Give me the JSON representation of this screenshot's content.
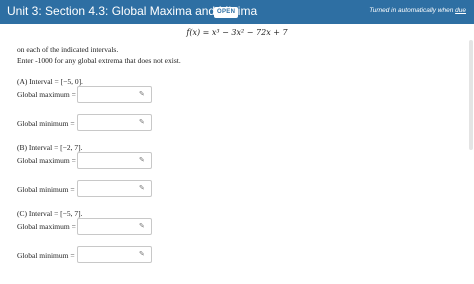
{
  "header": {
    "title": "Unit 3: Section 4.3: Global Maxima and Minima",
    "badge": "OPEN",
    "notice_prefix": "Turned in automatically when ",
    "notice_link": "due"
  },
  "problem": {
    "formula": "f(x) = x³ − 3x² − 72x + 7",
    "instruction_1": "on each of the indicated intervals.",
    "instruction_2": "Enter -1000 for any global extrema that does not exist."
  },
  "parts": [
    {
      "label": "(A) Interval = [−5, 0].",
      "max_label": "Global maximum =",
      "min_label": "Global minimum =",
      "max_value": "",
      "min_value": ""
    },
    {
      "label": "(B) Interval = [−2, 7].",
      "max_label": "Global maximum =",
      "min_label": "Global minimum =",
      "max_value": "",
      "min_value": ""
    },
    {
      "label": "(C) Interval = [−5, 7].",
      "max_label": "Global maximum =",
      "min_label": "Global minimum =",
      "max_value": "",
      "min_value": ""
    }
  ],
  "icons": {
    "edit": "pencil-icon"
  },
  "colors": {
    "header_bg": "#2e6fa3"
  }
}
